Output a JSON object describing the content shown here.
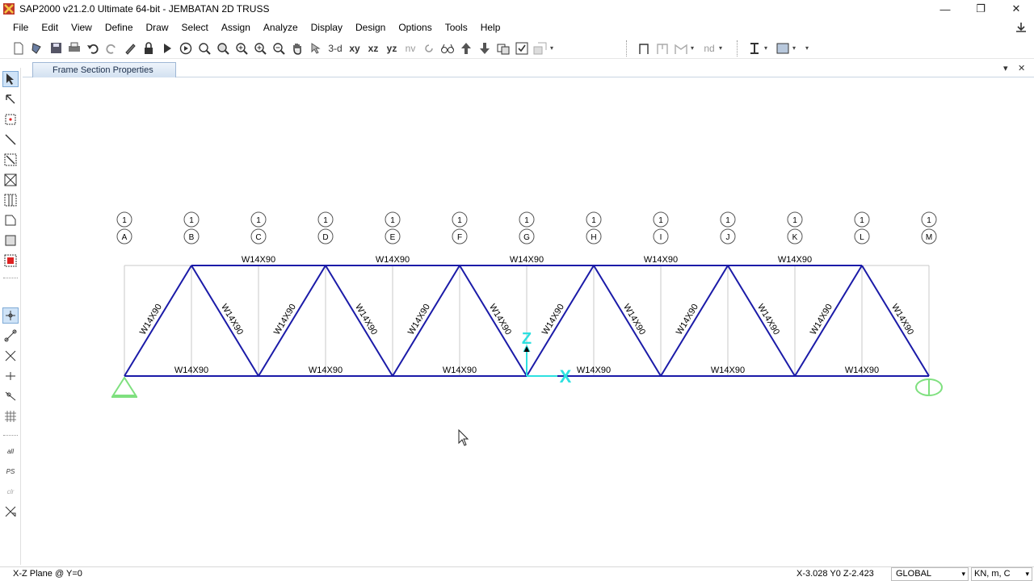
{
  "window": {
    "title": "SAP2000 v21.2.0 Ultimate 64-bit - JEMBATAN 2D TRUSS",
    "minimize": "—",
    "restore": "❐",
    "close": "✕"
  },
  "menu": [
    "File",
    "Edit",
    "View",
    "Define",
    "Draw",
    "Select",
    "Assign",
    "Analyze",
    "Display",
    "Design",
    "Options",
    "Tools",
    "Help"
  ],
  "toolbar": {
    "view_3d": "3-d",
    "view_xy": "xy",
    "view_xz": "xz",
    "view_yz": "yz",
    "view_nv": "nv",
    "view_nd": "nd"
  },
  "tab": {
    "label": "Frame Section Properties",
    "dropdown": "▾",
    "close": "✕"
  },
  "lefttools": {
    "all": "all",
    "ps": "PS",
    "clr": "clr"
  },
  "model": {
    "grid_columns": [
      "A",
      "B",
      "C",
      "D",
      "E",
      "F",
      "G",
      "H",
      "I",
      "J",
      "K",
      "L",
      "M"
    ],
    "grid_row_label": "1",
    "top_chord_labels": [
      "W14X90",
      "W14X90",
      "W14X90",
      "W14X90",
      "W14X90"
    ],
    "bottom_chord_labels": [
      "W14X90",
      "W14X90",
      "W14X90",
      "W14X90",
      "W14X90",
      "W14X90"
    ],
    "diagonal_label": "W14X90",
    "axis_z": "Z",
    "axis_x": "X",
    "member_color": "#1b1ba8",
    "grid_color": "#c8c8c8",
    "support_color": "#7fe07f",
    "axis_color": "#2de0e0"
  },
  "status": {
    "plane": "X-Z Plane @ Y=0",
    "coords": "X-3.028  Y0  Z-2.423",
    "coord_system": "GLOBAL",
    "units": "KN, m, C"
  }
}
